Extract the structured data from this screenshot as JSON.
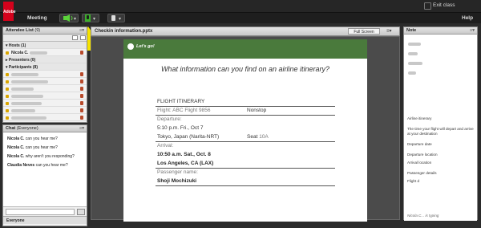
{
  "app": {
    "logo_text": "Adobe",
    "meeting_menu": "Meeting",
    "exit_label": "Exit class",
    "help_label": "Help"
  },
  "attendees": {
    "title": "Attendee List",
    "count": "(9)",
    "hosts_label": "Hosts (1)",
    "host_name": "Nicola C.",
    "presenters_label": "Presenters (0)",
    "participants_label": "Participants (8)"
  },
  "chat": {
    "title": "Chat",
    "scope": "(Everyone)",
    "messages": [
      {
        "name": "Nicola C.",
        "text": "can you hear me?"
      },
      {
        "name": "Nicola C.",
        "text": "can you hear me?"
      },
      {
        "name": "Nicola C.",
        "text": "why aren't you responding?"
      },
      {
        "name": "Claudia Neves",
        "text": "can you hear me?"
      }
    ],
    "recipient_tab": "Everyone"
  },
  "share": {
    "filename": "Checkin information.pptx",
    "fullscreen_label": "Full Screen",
    "slide": {
      "tag": "Let's go!",
      "question": "What information can you find on an airline itinerary?",
      "header": "FLIGHT ITINERARY",
      "flight": "Flight: ABC Flight 9856",
      "nonstop": "Nonstop",
      "departure_label": "Departure:",
      "dep_time": "5:10 p.m. Fri., Oct 7",
      "dep_place": "Tokyo, Japan (Narita-NRT)",
      "seat_prefix": "Seat ",
      "seat": "10A",
      "arrival_label": "Arrival:",
      "arr_time": "10:50 a.m. Sat., Oct. 8",
      "arr_place": "Los Angeles, CA (LAX)",
      "passenger_label": "Passenger name:",
      "passenger": "Shoji Mochizuki"
    }
  },
  "note": {
    "title": "Note",
    "lines": [
      "Airline itinerary",
      "The time your flight will depart and arrive at your destination",
      "Departure date",
      "Departure location",
      "Arrival location",
      "Passenger details",
      "Flight d"
    ],
    "typing": "Nicola C... is typing"
  }
}
